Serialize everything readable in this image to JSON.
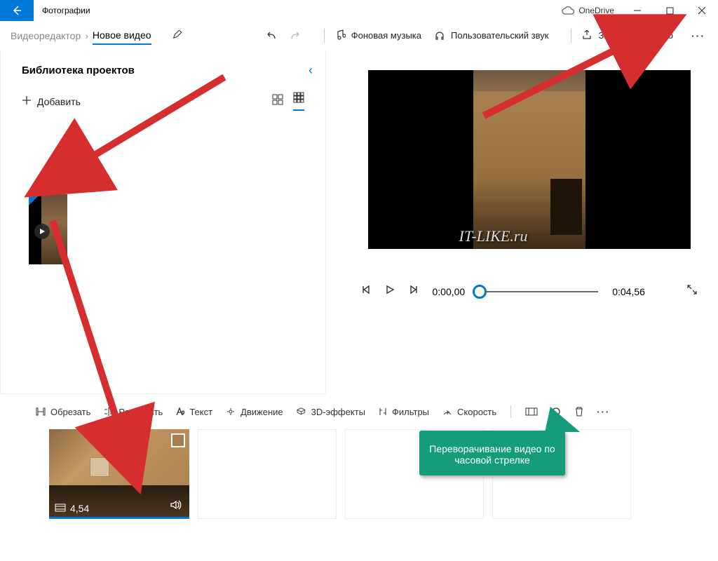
{
  "titlebar": {
    "app": "Фотографии",
    "onedrive": "OneDrive"
  },
  "secbar": {
    "prev": "Видеоредактор",
    "cur": "Новое видео",
    "bg_music": "Фоновая музыка",
    "custom_audio": "Пользовательский звук",
    "finish": "Завершить видео"
  },
  "library": {
    "title": "Библиотека проектов",
    "add": "Добавить"
  },
  "player": {
    "t0": "0:00,00",
    "t1": "0:04,56"
  },
  "watermark": "IT-LIKE.ru",
  "toolbar": {
    "trim": "Обрезать",
    "split": "Разделить",
    "text": "Текст",
    "motion": "Движение",
    "fx3d": "3D-эффекты",
    "filters": "Фильтры",
    "speed": "Скорость"
  },
  "storyboard": {
    "duration": "4,54"
  },
  "callout": "Переворачивание видео по часовой стрелке"
}
